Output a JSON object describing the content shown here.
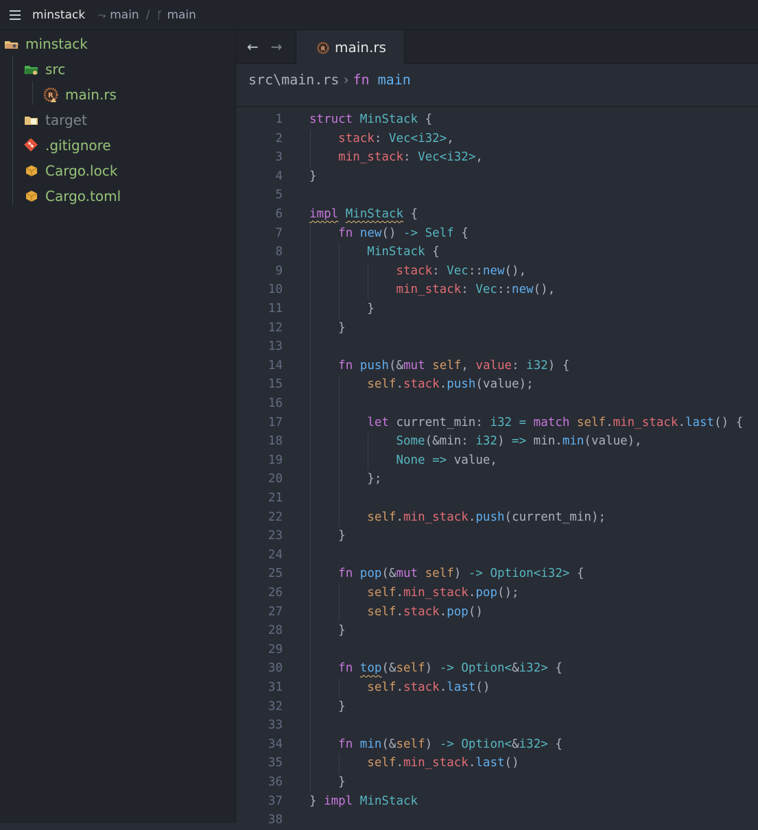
{
  "titlebar": {
    "project": "minstack",
    "branch_a": "main",
    "branch_b": "main"
  },
  "sidebar": {
    "items": [
      {
        "label": "minstack",
        "icon": "folder-open-icon",
        "color": "#98c379"
      },
      {
        "label": "src",
        "icon": "folder-src-icon",
        "color": "#98c379"
      },
      {
        "label": "main.rs",
        "icon": "rust-file-icon",
        "color": "#98c379"
      },
      {
        "label": "target",
        "icon": "folder-icon",
        "color": "#7f848e"
      },
      {
        "label": ".gitignore",
        "icon": "git-icon",
        "color": "#98c379"
      },
      {
        "label": "Cargo.lock",
        "icon": "cargo-icon",
        "color": "#98c379"
      },
      {
        "label": "Cargo.toml",
        "icon": "cargo-icon",
        "color": "#98c379"
      }
    ]
  },
  "tabs": {
    "back": "←",
    "forward": "→",
    "active_tab": "main.rs"
  },
  "breadcrumb": {
    "path": "src\\main.rs",
    "separator": "›",
    "keyword": "fn",
    "symbol": "main"
  },
  "code": {
    "line_numbers": [
      "1",
      "2",
      "3",
      "4",
      "5",
      "6",
      "7",
      "8",
      "9",
      "10",
      "11",
      "12",
      "13",
      "14",
      "15",
      "16",
      "17",
      "18",
      "19",
      "20",
      "21",
      "22",
      "23",
      "24",
      "25",
      "26",
      "27",
      "28",
      "29",
      "30",
      "31",
      "32",
      "33",
      "34",
      "35",
      "36",
      "37",
      "38"
    ],
    "lines": [
      "struct MinStack {",
      "    stack: Vec<i32>,",
      "    min_stack: Vec<i32>,",
      "}",
      "",
      "impl MinStack {",
      "    fn new() -> Self {",
      "        MinStack {",
      "            stack: Vec::new(),",
      "            min_stack: Vec::new(),",
      "        }",
      "    }",
      "",
      "    fn push(&mut self, value: i32) {",
      "        self.stack.push(value);",
      "",
      "        let current_min: i32 = match self.min_stack.last() {",
      "            Some(&min: i32) => min.min(value),",
      "            None => value,",
      "        };",
      "",
      "        self.min_stack.push(current_min);",
      "    }",
      "",
      "    fn pop(&mut self) -> Option<i32> {",
      "        self.min_stack.pop();",
      "        self.stack.pop()",
      "    }",
      "",
      "    fn top(&self) -> Option<&i32> {",
      "        self.stack.last()",
      "    }",
      "",
      "    fn min(&self) -> Option<&i32> {",
      "        self.min_stack.last()",
      "    }",
      "} impl MinStack",
      ""
    ]
  },
  "colors": {
    "background": "#282c34",
    "sidebar": "#21252b",
    "keyword": "#c678dd",
    "type": "#56b6c2",
    "field": "#e06c75",
    "function": "#61afef",
    "self": "#d19a66",
    "plain": "#abb2bf",
    "line_number": "#636d83",
    "tree_label": "#98c379"
  }
}
